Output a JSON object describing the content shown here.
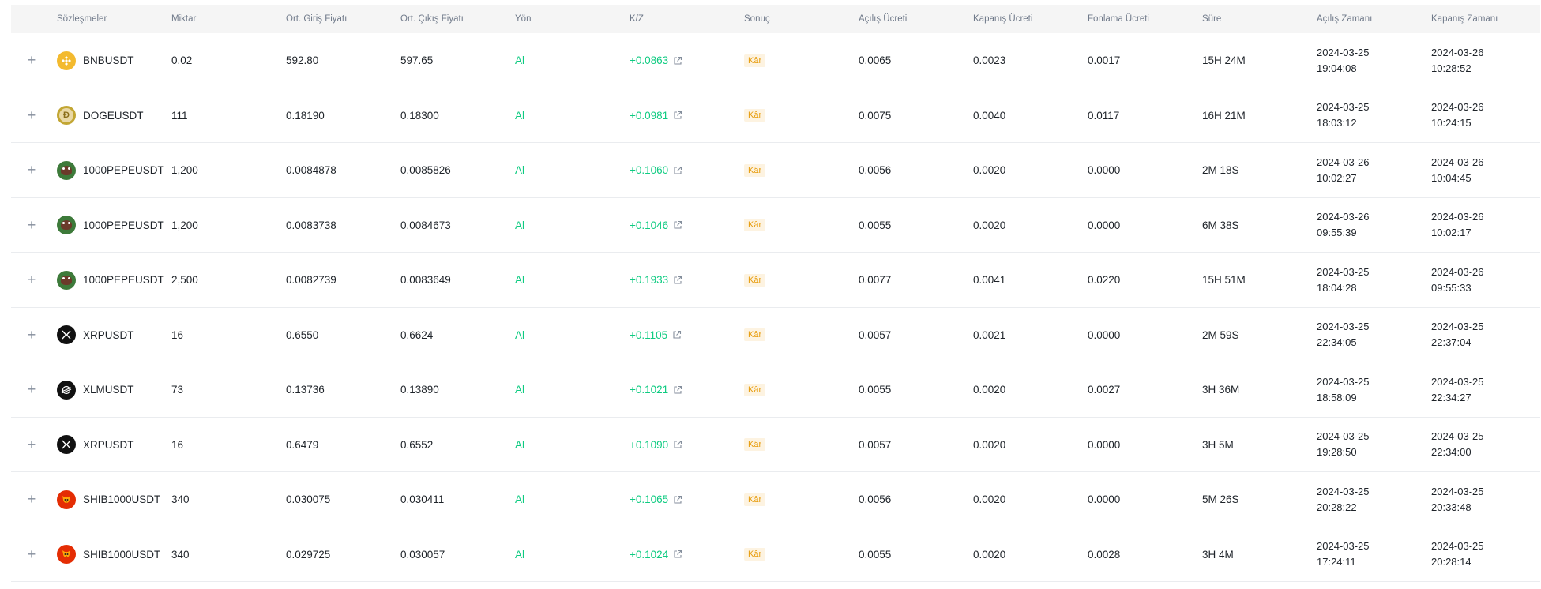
{
  "columns": {
    "contract": "Sözleşmeler",
    "qty": "Miktar",
    "entry": "Ort. Giriş Fiyatı",
    "exit": "Ort. Çıkış Fiyatı",
    "side": "Yön",
    "pnl": "K/Z",
    "result": "Sonuç",
    "open_fee": "Açılış Ücreti",
    "close_fee": "Kapanış Ücreti",
    "funding_fee": "Fonlama Ücreti",
    "duration": "Süre",
    "open_time": "Açılış Zamanı",
    "close_time": "Kapanış Zamanı"
  },
  "expand_symbol": "+",
  "colors": {
    "profit": "#0ecb81",
    "badge_bg": "#fdf3e1",
    "badge_text": "#e79c0c",
    "header_bg": "#f5f5f5"
  },
  "rows": [
    {
      "coin": "bnb",
      "symbol": "BNBUSDT",
      "qty": "0.02",
      "entry": "592.80",
      "exit": "597.65",
      "side": "Al",
      "pnl": "+0.0863",
      "result": "Kâr",
      "open_fee": "0.0065",
      "close_fee": "0.0023",
      "funding_fee": "0.0017",
      "duration": "15H 24M",
      "open_date": "2024-03-25",
      "open_clock": "19:04:08",
      "close_date": "2024-03-26",
      "close_clock": "10:28:52"
    },
    {
      "coin": "doge",
      "symbol": "DOGEUSDT",
      "qty": "111",
      "entry": "0.18190",
      "exit": "0.18300",
      "side": "Al",
      "pnl": "+0.0981",
      "result": "Kâr",
      "open_fee": "0.0075",
      "close_fee": "0.0040",
      "funding_fee": "0.0117",
      "duration": "16H 21M",
      "open_date": "2024-03-25",
      "open_clock": "18:03:12",
      "close_date": "2024-03-26",
      "close_clock": "10:24:15"
    },
    {
      "coin": "pepe",
      "symbol": "1000PEPEUSDT",
      "qty": "1,200",
      "entry": "0.0084878",
      "exit": "0.0085826",
      "side": "Al",
      "pnl": "+0.1060",
      "result": "Kâr",
      "open_fee": "0.0056",
      "close_fee": "0.0020",
      "funding_fee": "0.0000",
      "duration": "2M 18S",
      "open_date": "2024-03-26",
      "open_clock": "10:02:27",
      "close_date": "2024-03-26",
      "close_clock": "10:04:45"
    },
    {
      "coin": "pepe",
      "symbol": "1000PEPEUSDT",
      "qty": "1,200",
      "entry": "0.0083738",
      "exit": "0.0084673",
      "side": "Al",
      "pnl": "+0.1046",
      "result": "Kâr",
      "open_fee": "0.0055",
      "close_fee": "0.0020",
      "funding_fee": "0.0000",
      "duration": "6M 38S",
      "open_date": "2024-03-26",
      "open_clock": "09:55:39",
      "close_date": "2024-03-26",
      "close_clock": "10:02:17"
    },
    {
      "coin": "pepe",
      "symbol": "1000PEPEUSDT",
      "qty": "2,500",
      "entry": "0.0082739",
      "exit": "0.0083649",
      "side": "Al",
      "pnl": "+0.1933",
      "result": "Kâr",
      "open_fee": "0.0077",
      "close_fee": "0.0041",
      "funding_fee": "0.0220",
      "duration": "15H 51M",
      "open_date": "2024-03-25",
      "open_clock": "18:04:28",
      "close_date": "2024-03-26",
      "close_clock": "09:55:33"
    },
    {
      "coin": "xrp",
      "symbol": "XRPUSDT",
      "qty": "16",
      "entry": "0.6550",
      "exit": "0.6624",
      "side": "Al",
      "pnl": "+0.1105",
      "result": "Kâr",
      "open_fee": "0.0057",
      "close_fee": "0.0021",
      "funding_fee": "0.0000",
      "duration": "2M 59S",
      "open_date": "2024-03-25",
      "open_clock": "22:34:05",
      "close_date": "2024-03-25",
      "close_clock": "22:37:04"
    },
    {
      "coin": "xlm",
      "symbol": "XLMUSDT",
      "qty": "73",
      "entry": "0.13736",
      "exit": "0.13890",
      "side": "Al",
      "pnl": "+0.1021",
      "result": "Kâr",
      "open_fee": "0.0055",
      "close_fee": "0.0020",
      "funding_fee": "0.0027",
      "duration": "3H 36M",
      "open_date": "2024-03-25",
      "open_clock": "18:58:09",
      "close_date": "2024-03-25",
      "close_clock": "22:34:27"
    },
    {
      "coin": "xrp",
      "symbol": "XRPUSDT",
      "qty": "16",
      "entry": "0.6479",
      "exit": "0.6552",
      "side": "Al",
      "pnl": "+0.1090",
      "result": "Kâr",
      "open_fee": "0.0057",
      "close_fee": "0.0020",
      "funding_fee": "0.0000",
      "duration": "3H 5M",
      "open_date": "2024-03-25",
      "open_clock": "19:28:50",
      "close_date": "2024-03-25",
      "close_clock": "22:34:00"
    },
    {
      "coin": "shib",
      "symbol": "SHIB1000USDT",
      "qty": "340",
      "entry": "0.030075",
      "exit": "0.030411",
      "side": "Al",
      "pnl": "+0.1065",
      "result": "Kâr",
      "open_fee": "0.0056",
      "close_fee": "0.0020",
      "funding_fee": "0.0000",
      "duration": "5M 26S",
      "open_date": "2024-03-25",
      "open_clock": "20:28:22",
      "close_date": "2024-03-25",
      "close_clock": "20:33:48"
    },
    {
      "coin": "shib",
      "symbol": "SHIB1000USDT",
      "qty": "340",
      "entry": "0.029725",
      "exit": "0.030057",
      "side": "Al",
      "pnl": "+0.1024",
      "result": "Kâr",
      "open_fee": "0.0055",
      "close_fee": "0.0020",
      "funding_fee": "0.0028",
      "duration": "3H 4M",
      "open_date": "2024-03-25",
      "open_clock": "17:24:11",
      "close_date": "2024-03-25",
      "close_clock": "20:28:14"
    }
  ]
}
